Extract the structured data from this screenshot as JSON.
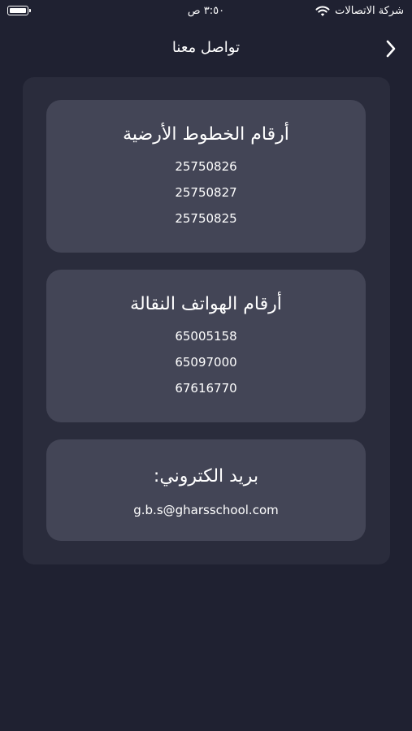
{
  "status_bar": {
    "carrier": "شركة الاتصالات",
    "time": "٣:٥٠ ص"
  },
  "header": {
    "title": "تواصل معنا",
    "back_icon": "chevron-right-icon"
  },
  "cards": [
    {
      "title": "أرقام الخطوط الأرضية",
      "lines": [
        "25750826",
        "25750827",
        "25750825"
      ]
    },
    {
      "title": "أرقام الهواتف النقالة",
      "lines": [
        "65005158",
        "65097000",
        "67616770"
      ]
    },
    {
      "title": "بريد الكتروني:",
      "lines": [
        "g.b.s@gharsschool.com"
      ]
    }
  ],
  "colors": {
    "background": "#1f2131",
    "panel": "#2a2c3c",
    "card": "#434556",
    "text": "#ffffff"
  }
}
